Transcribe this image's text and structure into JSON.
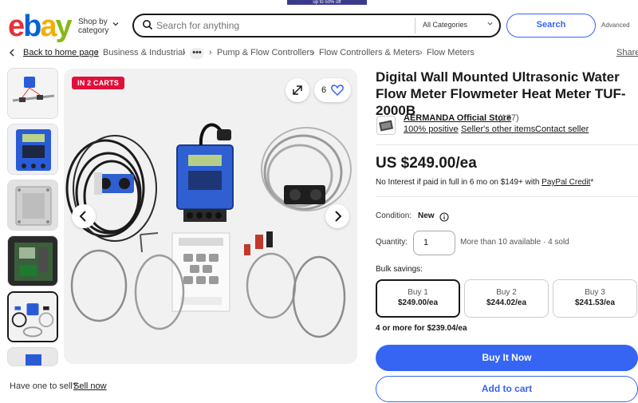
{
  "promo": {
    "text": "up to 50% off"
  },
  "header": {
    "logo": {
      "e": "e",
      "b": "b",
      "a": "a",
      "y": "y"
    },
    "shop_by_line1": "Shop by",
    "shop_by_line2": "category",
    "search_placeholder": "Search for anything",
    "category_select": "All Categories",
    "search_button": "Search",
    "advanced_link": "Advanced"
  },
  "breadcrumb": {
    "back": "Back to home page",
    "items": [
      "Business & Industrial",
      "Pump & Flow Controllers",
      "Flow Controllers & Meters",
      "Flow Meters"
    ],
    "more": "•••",
    "share": "Share"
  },
  "gallery": {
    "badge": "IN 2 CARTS",
    "watch_count": "6",
    "thumbnail_count": 6,
    "selected_thumbnail": 5
  },
  "sell": {
    "question": "Have one to sell?",
    "link": "Sell now"
  },
  "product": {
    "title": "Digital Wall Mounted Ultrasonic Water Flow Meter Flowmeter Heat Meter TUF-2000B",
    "seller": {
      "name": "AERMANDA Official Store",
      "feedback_count": "(137)",
      "positive": "100% positive",
      "other_items": "Seller's other items",
      "contact": "Contact seller"
    },
    "price": "US $249.00/ea",
    "financing_text": "No Interest if paid in full in 6 mo on $149+ with ",
    "financing_link": "PayPal Credit",
    "financing_suffix": "*",
    "condition_label": "Condition:",
    "condition_value": "New",
    "quantity_label": "Quantity:",
    "quantity_value": "1",
    "availability": "More than 10 available · 4 sold",
    "bulk_label": "Bulk savings:",
    "bulk_tiers": [
      {
        "label": "Buy 1",
        "price": "$249.00/ea"
      },
      {
        "label": "Buy 2",
        "price": "$244.02/ea"
      },
      {
        "label": "Buy 3",
        "price": "$241.53/ea"
      }
    ],
    "bulk_more": "4 or more for $239.04/ea",
    "buy_now": "Buy It Now",
    "add_to_cart": "Add to cart"
  },
  "colors": {
    "accent": "#3665f3",
    "badge": "#e0103a",
    "text": "#191919",
    "ebay_e": "#e53238",
    "ebay_b": "#0064d2",
    "ebay_a": "#f5af02",
    "ebay_y": "#86b817"
  },
  "icons": [
    "search-icon",
    "chevron-down-icon",
    "chevron-left-icon",
    "chevron-right-icon",
    "expand-icon",
    "heart-icon",
    "info-icon",
    "ellipsis-icon"
  ]
}
